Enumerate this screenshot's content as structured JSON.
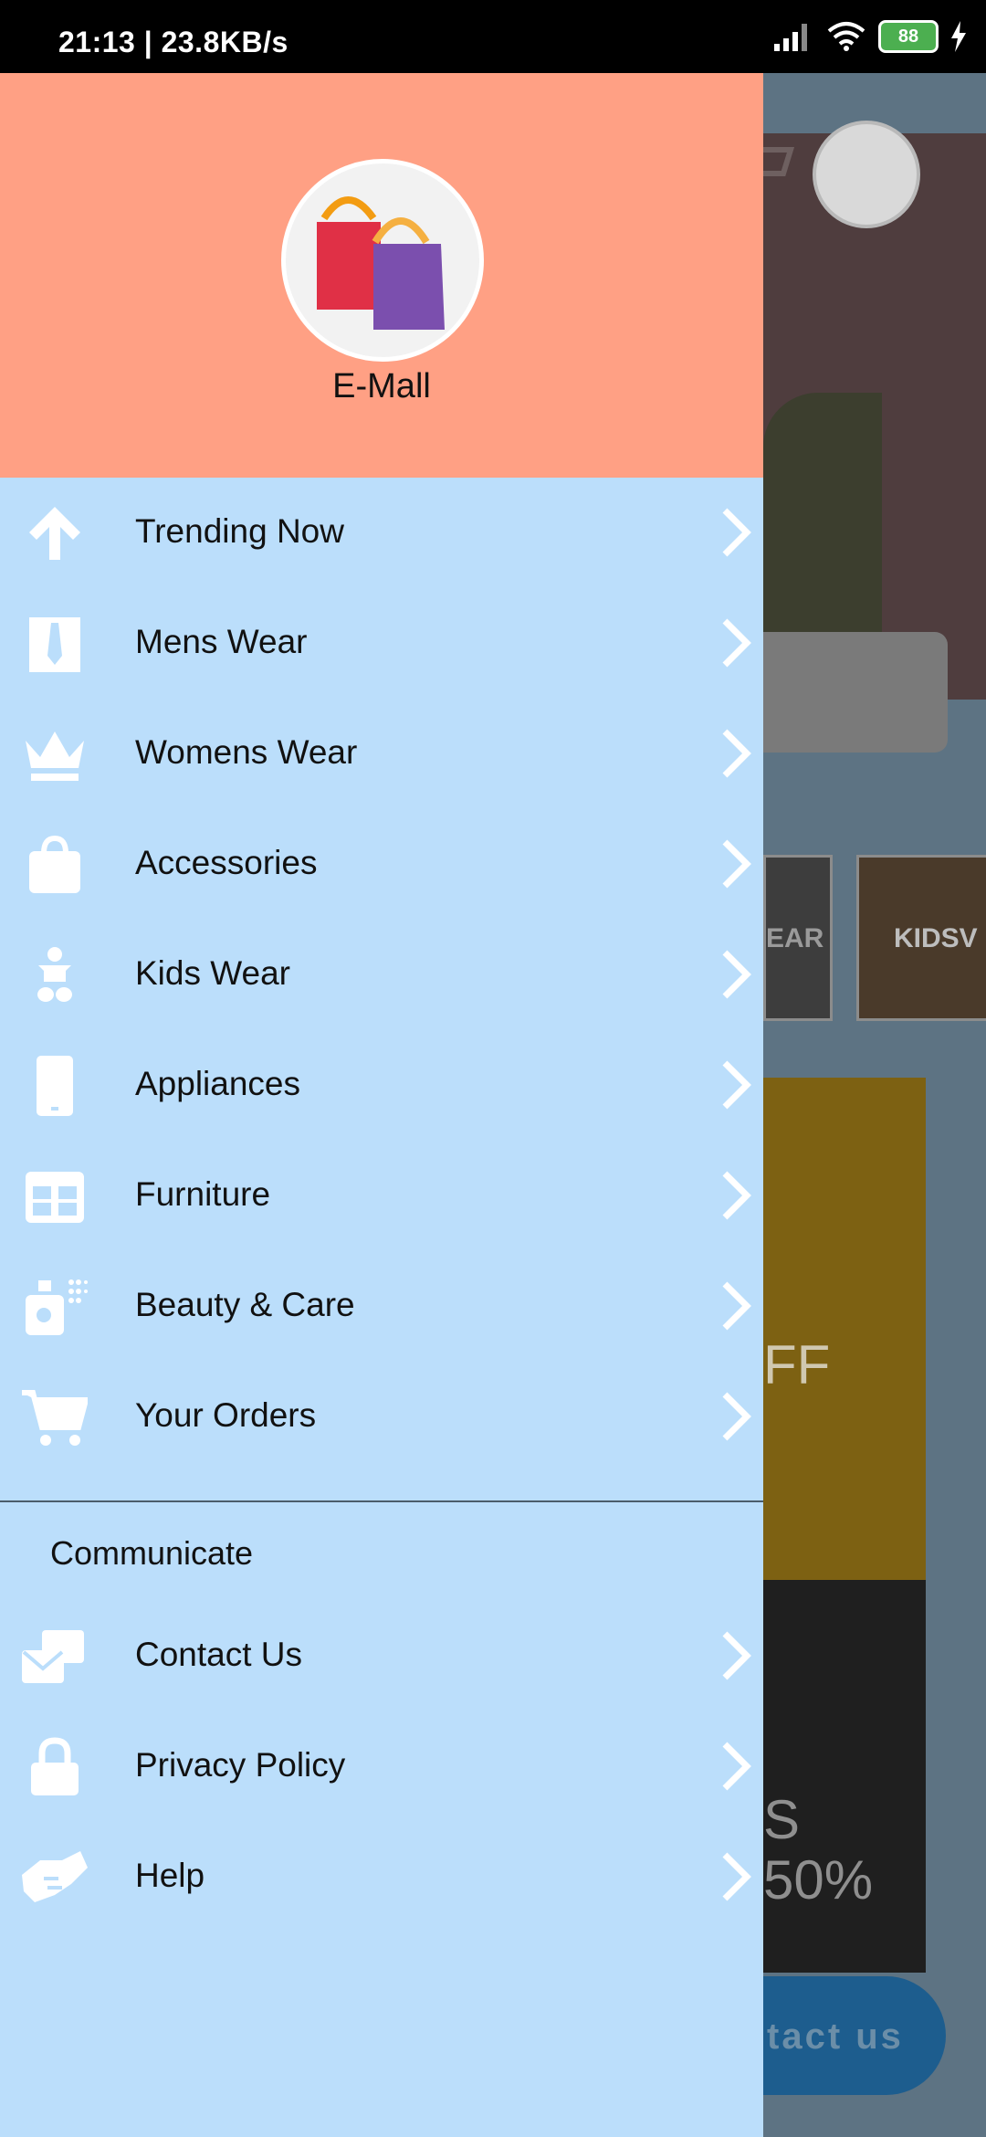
{
  "status_bar": {
    "time": "21:13 | 23.8KB/s",
    "battery": "88"
  },
  "drawer": {
    "brand_name": "E-Mall",
    "items": [
      {
        "label": "Trending Now",
        "icon": "arrow-up-icon"
      },
      {
        "label": "Mens Wear",
        "icon": "tie-icon"
      },
      {
        "label": "Womens Wear",
        "icon": "crown-icon"
      },
      {
        "label": "Accessories",
        "icon": "shopping-bag-icon"
      },
      {
        "label": "Kids Wear",
        "icon": "baby-icon"
      },
      {
        "label": "Appliances",
        "icon": "phone-icon"
      },
      {
        "label": "Furniture",
        "icon": "table-icon"
      },
      {
        "label": "Beauty & Care",
        "icon": "spray-icon"
      },
      {
        "label": "Your Orders",
        "icon": "cart-icon"
      }
    ],
    "section_title": "Communicate",
    "comm_items": [
      {
        "label": "Contact Us",
        "icon": "mail-icon"
      },
      {
        "label": "Privacy Policy",
        "icon": "lock-icon"
      },
      {
        "label": "Help",
        "icon": "handshake-icon"
      }
    ]
  },
  "background": {
    "tile1_text": "EAR",
    "tile2_text": "KIDSV",
    "banner1_text": "FF",
    "banner2_text": "S\n50%",
    "fab_text": "tact us"
  },
  "colors": {
    "drawer_bg": "#bbdefb",
    "header_bg": "#ffa084",
    "icon": "#ffffff"
  }
}
